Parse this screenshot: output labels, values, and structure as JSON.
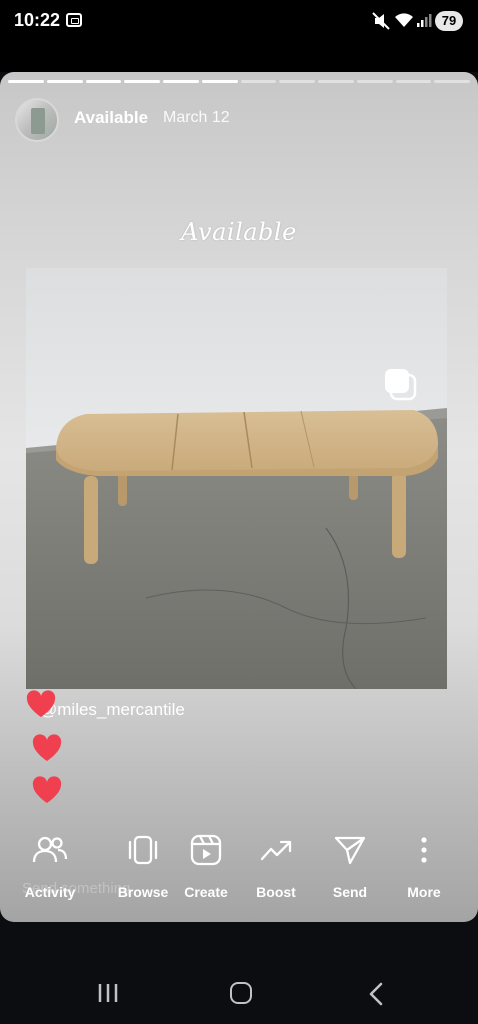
{
  "status_bar": {
    "time": "10:22",
    "battery": "79",
    "icons": [
      "screen-record-icon",
      "mute-icon",
      "wifi-icon",
      "signal-icon",
      "battery-icon"
    ]
  },
  "story": {
    "segments_total": 12,
    "segments_done": 6,
    "username": "Available",
    "date": "March 12",
    "overlay_title": "Available",
    "mention": "@miles_mercantile",
    "faded_text": "Send something",
    "colors": {
      "heart": "#f0404f",
      "text": "#ffffff"
    }
  },
  "actions": [
    {
      "key": "activity",
      "label": "Activity",
      "icon": "people-icon"
    },
    {
      "key": "browse",
      "label": "Browse",
      "icon": "browse-icon"
    },
    {
      "key": "create",
      "label": "Create",
      "icon": "reels-icon"
    },
    {
      "key": "boost",
      "label": "Boost",
      "icon": "trend-icon"
    },
    {
      "key": "send",
      "label": "Send",
      "icon": "send-icon"
    },
    {
      "key": "more",
      "label": "More",
      "icon": "more-vertical-icon"
    }
  ],
  "navigation": {
    "icons": [
      "recents-icon",
      "home-icon",
      "back-icon"
    ]
  }
}
